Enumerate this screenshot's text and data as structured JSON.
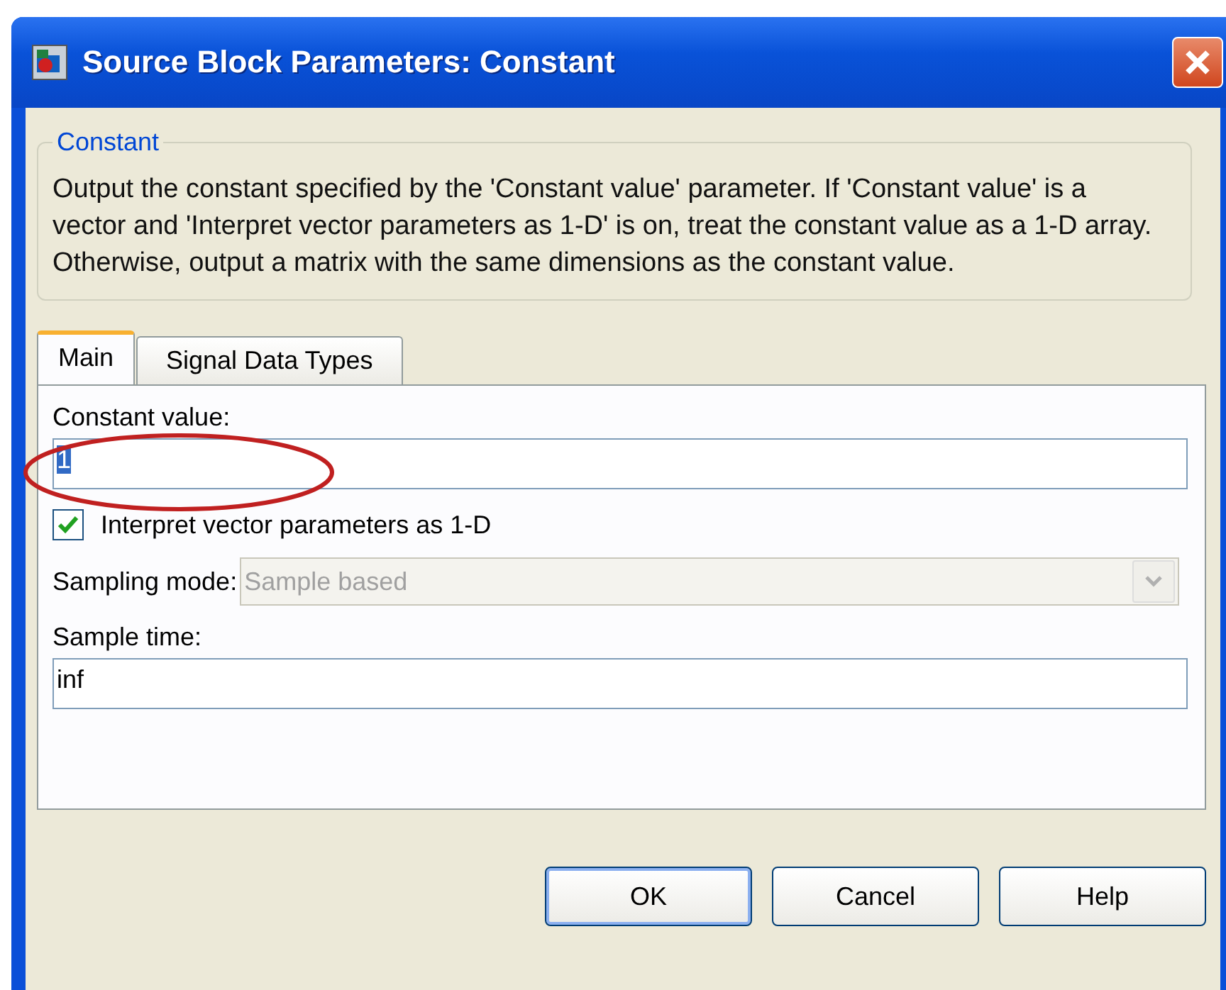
{
  "window": {
    "title": "Source Block Parameters: Constant"
  },
  "group": {
    "title": "Constant",
    "description": "Output the constant specified by the 'Constant value' parameter. If 'Constant value' is a vector and 'Interpret vector parameters as 1-D' is on, treat the constant value as a 1-D array. Otherwise, output a matrix with the same dimensions as the constant value."
  },
  "tabs": [
    {
      "label": "Main",
      "selected": true
    },
    {
      "label": "Signal Data Types",
      "selected": false
    }
  ],
  "constant_value": {
    "label": "Constant value:",
    "value": "1",
    "text_selected": true
  },
  "interpret_checkbox": {
    "label": "Interpret vector parameters as 1-D",
    "checked": true
  },
  "sampling_mode": {
    "label": "Sampling mode:",
    "value": "Sample based",
    "disabled": true
  },
  "sample_time": {
    "label": "Sample time:",
    "value": "inf"
  },
  "buttons": [
    {
      "label": "OK",
      "default": true
    },
    {
      "label": "Cancel",
      "default": false
    },
    {
      "label": "Help",
      "default": false
    }
  ]
}
